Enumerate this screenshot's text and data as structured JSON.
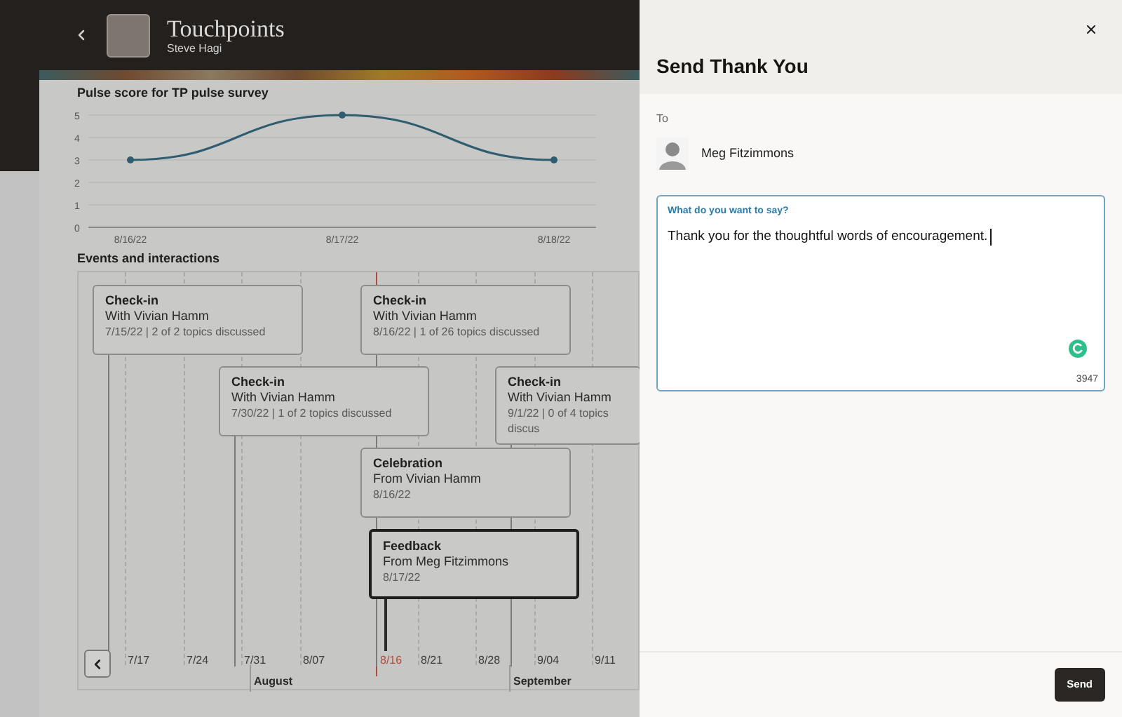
{
  "header": {
    "title": "Touchpoints",
    "subtitle": "Steve Hagi"
  },
  "pulse": {
    "title": "Pulse score for TP pulse survey",
    "chart_data": {
      "type": "line",
      "categories": [
        "8/16/22",
        "8/17/22",
        "8/18/22"
      ],
      "series": [
        {
          "color": "#2f5d70",
          "marker": true,
          "values": [
            3,
            5,
            3
          ]
        }
      ],
      "grid": true,
      "ylim": [
        0,
        5
      ],
      "yticks": [
        0,
        1,
        2,
        3,
        4,
        5
      ]
    }
  },
  "events": {
    "title": "Events and interactions",
    "items": [
      {
        "title": "Check-in",
        "subtitle": "With Vivian Hamm",
        "detail": "7/15/22 | 2 of 2 topics discussed",
        "selected": false
      },
      {
        "title": "Check-in",
        "subtitle": "With Vivian Hamm",
        "detail": "8/16/22 | 1 of 26 topics discussed",
        "selected": false
      },
      {
        "title": "Check-in",
        "subtitle": "With Vivian Hamm",
        "detail": "7/30/22 | 1 of 2 topics discussed",
        "selected": false
      },
      {
        "title": "Check-in",
        "subtitle": "With Vivian Hamm",
        "detail": "9/1/22 | 0 of 4 topics discus",
        "selected": false
      },
      {
        "title": "Celebration",
        "subtitle": "From Vivian Hamm",
        "detail": "8/16/22",
        "selected": false
      },
      {
        "title": "Feedback",
        "subtitle": "From Meg Fitzimmons",
        "detail": "8/17/22",
        "selected": true
      }
    ],
    "ticks": [
      {
        "label": "7/17",
        "current": false
      },
      {
        "label": "7/24",
        "current": false
      },
      {
        "label": "7/31",
        "current": false
      },
      {
        "label": "8/07",
        "current": false
      },
      {
        "label": "8/16",
        "current": true
      },
      {
        "label": "8/21",
        "current": false
      },
      {
        "label": "8/28",
        "current": false
      },
      {
        "label": "9/04",
        "current": false
      },
      {
        "label": "9/11",
        "current": false
      }
    ],
    "months": [
      "August",
      "September"
    ]
  },
  "drawer": {
    "title": "Send Thank You",
    "to_label": "To",
    "recipient": "Meg Fitzimmons",
    "message": {
      "label": "What do you want to say?",
      "value": "Thank you for the thoughtful words of encouragement.",
      "remaining": "3947"
    },
    "send": "Send"
  }
}
